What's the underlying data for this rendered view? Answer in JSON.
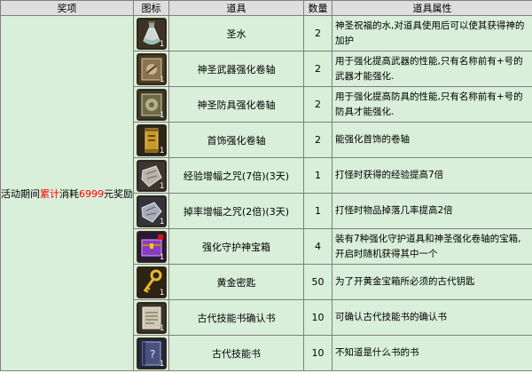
{
  "headers": {
    "award": "奖项",
    "icon": "图标",
    "item": "道具",
    "qty": "数量",
    "attr": "道具属性"
  },
  "award": {
    "prefix": "活动期间",
    "highlight": "累计",
    "middle": "消耗",
    "amount": "6999",
    "suffix": "元奖励",
    "highlight_color": "#ff0000"
  },
  "rows": [
    {
      "icon_name": "holy-water-icon",
      "icon_count": "1",
      "name": "圣水",
      "qty": "2",
      "attr": "神圣祝福的水,对道具使用后可以使其获得神的加护"
    },
    {
      "icon_name": "holy-weapon-scroll-icon",
      "icon_count": "1",
      "name": "神圣武器强化卷轴",
      "qty": "2",
      "attr": "用于强化提高武器的性能,只有名称前有+号的武器才能强化."
    },
    {
      "icon_name": "holy-armor-scroll-icon",
      "icon_count": "1",
      "name": "神圣防具强化卷轴",
      "qty": "2",
      "attr": "用于强化提高防具的性能,只有名称前有+号的防具才能强化."
    },
    {
      "icon_name": "accessory-scroll-icon",
      "icon_count": "1",
      "name": "首饰强化卷轴",
      "qty": "2",
      "attr": "能强化首饰的卷轴"
    },
    {
      "icon_name": "exp-curse-icon",
      "icon_count": "1",
      "name": "经验增幅之咒(7倍)(3天)",
      "qty": "1",
      "attr": "打怪时获得的经验提高7倍"
    },
    {
      "icon_name": "drop-curse-icon",
      "icon_count": "1",
      "name": "掉率增幅之咒(2倍)(3天)",
      "qty": "1",
      "attr": "打怪时物品掉落几率提高2倍"
    },
    {
      "icon_name": "treasure-chest-icon",
      "icon_count": "1",
      "name": "强化守护神宝箱",
      "qty": "4",
      "attr": "装有7种强化守护道具和神圣强化卷轴的宝箱,开启时随机获得其中一个"
    },
    {
      "icon_name": "golden-key-icon",
      "icon_count": "1",
      "name": "黄金密匙",
      "qty": "50",
      "attr": "为了开黄金宝箱所必须的古代钥匙"
    },
    {
      "icon_name": "skill-book-confirm-icon",
      "icon_count": "1",
      "name": "古代技能书确认书",
      "qty": "10",
      "attr": "可确认古代技能书的确认书"
    },
    {
      "icon_name": "ancient-skill-book-icon",
      "icon_count": "1",
      "name": "古代技能书",
      "qty": "10",
      "attr": "不知道是什么书的书"
    }
  ]
}
